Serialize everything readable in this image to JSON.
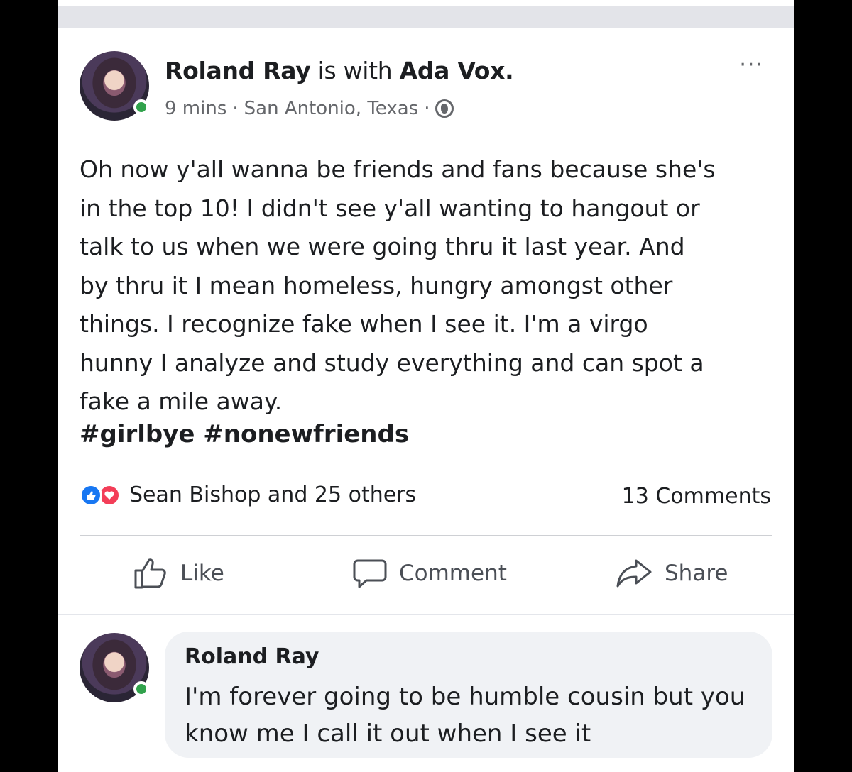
{
  "post": {
    "author": "Roland Ray",
    "with_text": " is with ",
    "tagged": "Ada Vox.",
    "time": "9 mins",
    "location": "San Antonio, Texas",
    "sep": "·",
    "more": "···",
    "body": "Oh now y'all wanna be friends and fans because she's\nin the top 10! I didn't see y'all wanting to hangout or\ntalk to us when we were going thru it last year. And\nby thru it I mean homeless, hungry amongst other\nthings. I recognize fake when I see it. I'm a virgo\nhunny I analyze and study everything and can spot a\nfake a mile away.",
    "hashtags": "#girlbye #nonewfriends",
    "reactions_text": "Sean Bishop and 25 others",
    "comments_count": "13 Comments"
  },
  "actions": {
    "like": "Like",
    "comment": "Comment",
    "share": "Share"
  },
  "comment": {
    "author": "Roland Ray",
    "text": "I'm forever going to be humble cousin but you know me I call it out when I see it"
  },
  "colors": {
    "like_blue": "#1877f2",
    "love_red": "#f33e58",
    "online_green": "#31a24c",
    "bubble_bg": "#f0f2f5"
  }
}
